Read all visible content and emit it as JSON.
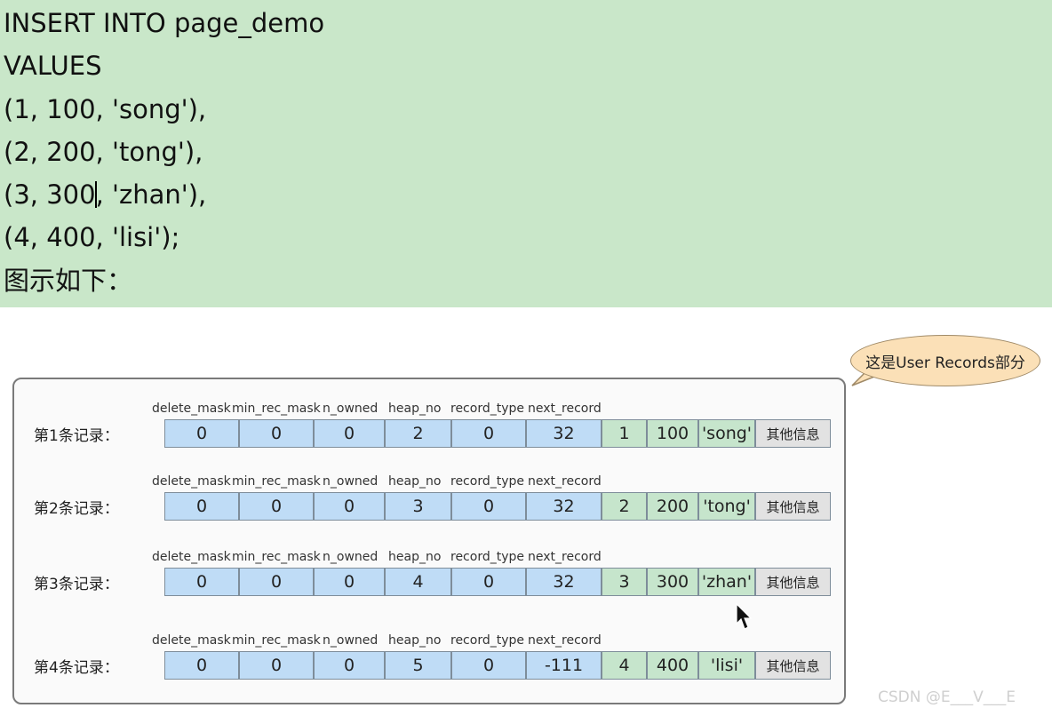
{
  "code": {
    "lines": [
      "INSERT INTO page_demo",
      "VALUES",
      "(1, 100, 'song'),",
      "(2, 200, 'tong'),",
      "(3, 300",
      "(4, 400, 'lisi');",
      "图示如下："
    ],
    "line5_after_caret": ", 'zhan'),"
  },
  "bubble": {
    "text": "这是User Records部分"
  },
  "headers": [
    "delete_mask",
    "min_rec_mask",
    "n_owned",
    "heap_no",
    "record_type",
    "next_record"
  ],
  "records": [
    {
      "label": "第1条记录：",
      "header_values": [
        "0",
        "0",
        "0",
        "2",
        "0",
        "32"
      ],
      "data": [
        "1",
        "100",
        "'song'"
      ],
      "other": "其他信息"
    },
    {
      "label": "第2条记录：",
      "header_values": [
        "0",
        "0",
        "0",
        "3",
        "0",
        "32"
      ],
      "data": [
        "2",
        "200",
        "'tong'"
      ],
      "other": "其他信息"
    },
    {
      "label": "第3条记录：",
      "header_values": [
        "0",
        "0",
        "0",
        "4",
        "0",
        "32"
      ],
      "data": [
        "3",
        "300",
        "'zhan'"
      ],
      "other": "其他信息"
    },
    {
      "label": "第4条记录：",
      "header_values": [
        "0",
        "0",
        "0",
        "5",
        "0",
        "-111"
      ],
      "data": [
        "4",
        "400",
        "'lisi'"
      ],
      "other": "其他信息"
    }
  ],
  "watermark": "CSDN @E___V___E",
  "colors": {
    "code_bg": "#c9e7c9",
    "header_cell": "#bfdcf6",
    "data_cell": "#c6e5cc",
    "other_cell": "#e2e2e2",
    "bubble": "#fbe0b7"
  }
}
